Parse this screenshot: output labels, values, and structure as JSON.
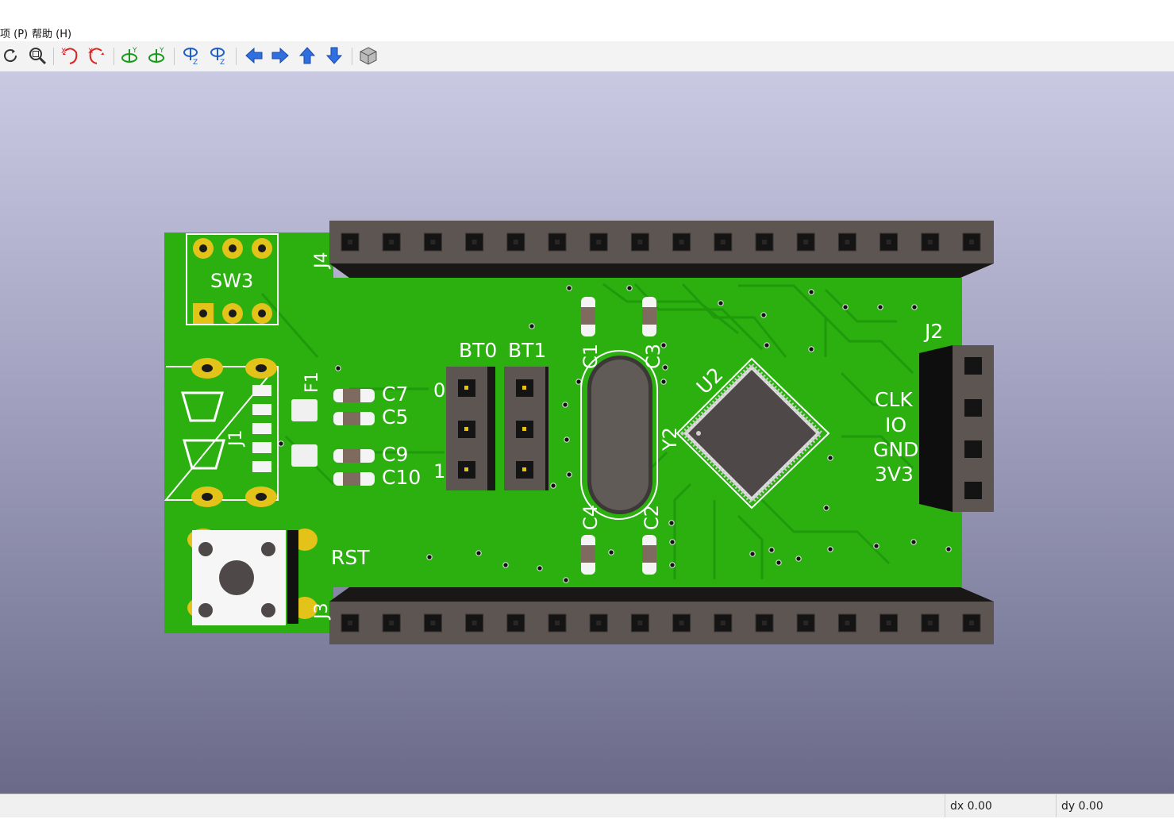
{
  "menubar": {
    "items": [
      "项 (P)",
      "帮助 (H)"
    ]
  },
  "toolbar": {
    "icons": [
      "reload-icon",
      "zoom-fit-icon",
      "rotate-x-cw-icon",
      "rotate-x-ccw-icon",
      "rotate-y-cw-icon",
      "rotate-y-ccw-icon",
      "rotate-z-cw-icon",
      "rotate-z-ccw-icon",
      "pan-left-icon",
      "pan-right-icon",
      "pan-up-icon",
      "pan-down-icon",
      "view-3d-box-icon"
    ],
    "axis_labels": {
      "x": "X",
      "y": "Y",
      "z": "Z"
    }
  },
  "board": {
    "refs": {
      "sw3": "SW3",
      "j4": "J4",
      "j3": "J3",
      "j1": "J1",
      "f1": "F1",
      "c7": "C7",
      "c5": "C5",
      "c9": "C9",
      "c10": "C10",
      "bt0": "BT0",
      "bt1": "BT1",
      "c1": "C1",
      "c3": "C3",
      "c4": "C4",
      "c2": "C2",
      "y2": "Y2",
      "u2": "U2",
      "j2": "J2",
      "rst": "RST"
    },
    "jumper_marks": {
      "top": "0",
      "bottom": "1"
    },
    "swd_labels": [
      "CLK",
      "IO",
      "GND",
      "3V3"
    ],
    "colors": {
      "pcb": "#2bb010",
      "silk": "#ffffff",
      "pad": "#e3c21a",
      "header": "#5c5552",
      "dark_trace": "#1f9a0a"
    }
  },
  "status": {
    "dx": "dx 0.00",
    "dy": "dy 0.00"
  }
}
